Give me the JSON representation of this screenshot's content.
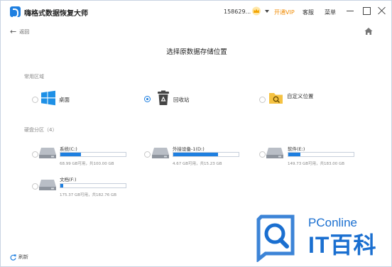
{
  "app": {
    "title": "嗨格式数据恢复大师",
    "user_id": "158629...",
    "vip_label": "开通VIP",
    "service_label": "客服",
    "menu_label": "菜单"
  },
  "nav": {
    "back_label": "返回"
  },
  "page": {
    "title": "选择原数据存储位置"
  },
  "common": {
    "section_label": "常用区域",
    "items": [
      {
        "label": "桌面",
        "icon": "windows-desktop-icon",
        "selected": false
      },
      {
        "label": "回收站",
        "icon": "recycle-bin-icon",
        "selected": true
      },
      {
        "label": "自定义位置",
        "icon": "folder-search-icon",
        "selected": false
      }
    ]
  },
  "disks": {
    "section_label": "硬盘分区（4）",
    "items": [
      {
        "name": "系统(C:)",
        "usage_fraction": 0.31,
        "size_text": "68.99 GB可用，共100.00 GB"
      },
      {
        "name": "外接设备-1(D:)",
        "usage_fraction": 0.69,
        "size_text": "4.67 GB可用，共15.23 GB"
      },
      {
        "name": "软件(E:)",
        "usage_fraction": 0.18,
        "size_text": "149.73 GB可用，共183.00 GB"
      },
      {
        "name": "文档(F:)",
        "usage_fraction": 0.04,
        "size_text": "175.37 GB可用，共182.76 GB"
      }
    ]
  },
  "footer": {
    "refresh_label": "刷新"
  },
  "watermark": {
    "brand": "PConline",
    "big_text": "IT百科"
  },
  "colors": {
    "accent": "#1e7fe0",
    "vip": "#f08a00",
    "recycle_bin": "#444444",
    "folder": "#f5c242"
  }
}
